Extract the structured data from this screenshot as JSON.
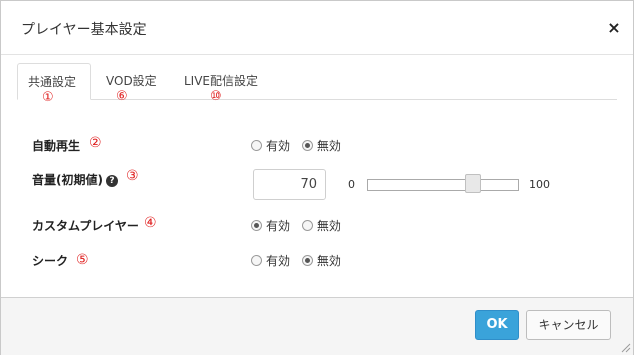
{
  "dialog": {
    "title": "プレイヤー基本設定",
    "close_label": "×"
  },
  "tabs": [
    {
      "label": "共通設定",
      "marker": "①",
      "active": true
    },
    {
      "label": "VOD設定",
      "marker": "⑥",
      "active": false
    },
    {
      "label": "LIVE配信設定",
      "marker": "⑩",
      "active": false
    }
  ],
  "settings": {
    "autoplay": {
      "label": "自動再生",
      "marker": "②",
      "options": [
        "有効",
        "無効"
      ],
      "selected": "無効"
    },
    "volume": {
      "label": "音量(初期値)",
      "help_icon": "?",
      "marker": "③",
      "value": "70",
      "min_label": "0",
      "max_label": "100",
      "slider_fraction": 0.7
    },
    "custom_player": {
      "label": "カスタムプレイヤー",
      "marker": "④",
      "options": [
        "有効",
        "無効"
      ],
      "selected": "有効"
    },
    "seek": {
      "label": "シーク",
      "marker": "⑤",
      "options": [
        "有効",
        "無効"
      ],
      "selected": "無効"
    }
  },
  "footer": {
    "ok_label": "OK",
    "cancel_label": "キャンセル"
  },
  "colors": {
    "ok_button": "#3aa3da",
    "marker_red": "#e02020"
  }
}
